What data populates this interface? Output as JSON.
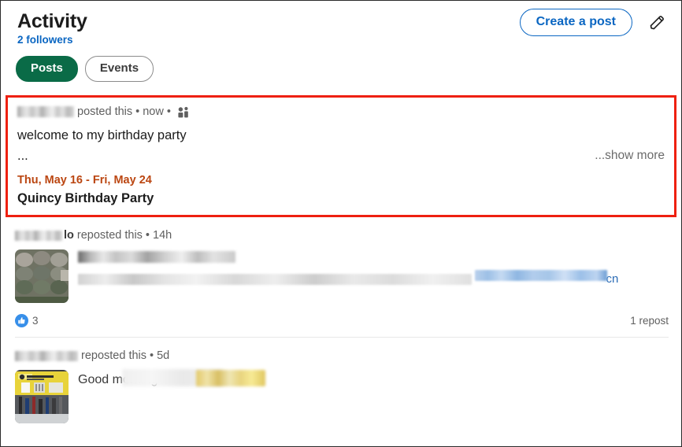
{
  "header": {
    "title": "Activity",
    "followers": "2 followers",
    "create_post_label": "Create a post",
    "edit_icon": "pencil-icon"
  },
  "filters": [
    {
      "label": "Posts",
      "selected": true
    },
    {
      "label": "Events",
      "selected": false
    }
  ],
  "colors": {
    "accent_blue": "#0a66c2",
    "selected_pill_green": "#0a6b47",
    "highlight_red": "#ee2010",
    "event_date_orange": "#bb4611",
    "like_blue": "#378fe9"
  },
  "feed": {
    "posts": [
      {
        "actor_name": "",
        "action": "posted this",
        "separator1": "•",
        "timestamp": "now",
        "separator2": "•",
        "visibility_icon": "group-visibility-icon",
        "body": "welcome to my birthday party",
        "truncation": "...",
        "show_more": "...show more",
        "event_date": "Thu, May 16 - Fri, May 24",
        "event_title": "Quincy Birthday Party",
        "highlighted": true
      },
      {
        "actor_name": "lo",
        "action": "reposted this",
        "separator1": "•",
        "timestamp": "14h",
        "thumbnail": "metal-bolt-heads-photo",
        "link_suffix": "cn",
        "reaction_icon": "thumbs-up-icon",
        "reaction_count": "3",
        "repost_count": "1 repost"
      },
      {
        "actor_name": "",
        "action": "reposted this",
        "separator1": "•",
        "timestamp": "5d",
        "thumbnail": "fastener-booth-photo",
        "body_prefix": "Good morning"
      }
    ]
  }
}
